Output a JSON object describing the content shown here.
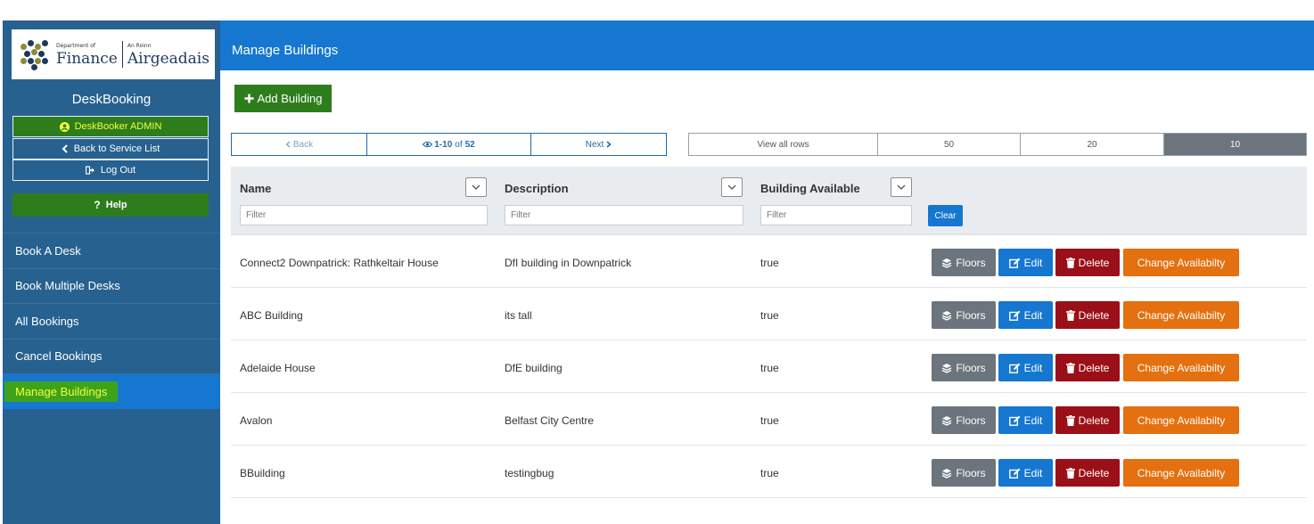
{
  "sidebar": {
    "logo": {
      "dept_small": "Department of",
      "dept_big": "Finance",
      "irish_small": "An Roinn",
      "irish_big": "Airgeadais"
    },
    "app_name": "DeskBooking",
    "admin_label": "DeskBooker ADMIN",
    "back_label": "Back to Service List",
    "logout_label": "Log Out",
    "help_label": "Help",
    "nav": [
      {
        "label": "Book A Desk"
      },
      {
        "label": "Book Multiple Desks"
      },
      {
        "label": "All Bookings"
      },
      {
        "label": "Cancel Bookings"
      },
      {
        "label": "Manage Buildings",
        "active": true
      }
    ]
  },
  "header": {
    "title": "Manage Buildings"
  },
  "toolbar": {
    "add_label": "Add Building"
  },
  "pager": {
    "back": "Back",
    "range": "1-10",
    "of_text": "of",
    "total": "52",
    "next": "Next"
  },
  "row_size": {
    "options": [
      "View all rows",
      "50",
      "20",
      "10"
    ],
    "selected": "10"
  },
  "table": {
    "columns": [
      {
        "label": "Name",
        "filter_placeholder": "Filter"
      },
      {
        "label": "Description",
        "filter_placeholder": "Filter"
      },
      {
        "label": "Building Available",
        "filter_placeholder": "Filter"
      }
    ],
    "clear_label": "Clear",
    "actions": {
      "floors": "Floors",
      "edit": "Edit",
      "delete": "Delete",
      "availability": "Change Availabilty"
    },
    "rows": [
      {
        "name": "Connect2 Downpatrick: Rathkeltair House",
        "description": "DfI building in Downpatrick",
        "available": "true"
      },
      {
        "name": "ABC Building",
        "description": "its tall",
        "available": "true"
      },
      {
        "name": "Adelaide House",
        "description": "DfE building",
        "available": "true"
      },
      {
        "name": "Avalon",
        "description": "Belfast City Centre",
        "available": "true"
      },
      {
        "name": "BBuilding",
        "description": "testingbug",
        "available": "true"
      }
    ]
  },
  "colors": {
    "primary": "#1577cf",
    "sidebar": "#27618f",
    "success": "#2e7d1c",
    "danger": "#9b1018",
    "warning": "#e4700f",
    "secondary": "#6c757d",
    "highlight": "#f5ff3a"
  }
}
